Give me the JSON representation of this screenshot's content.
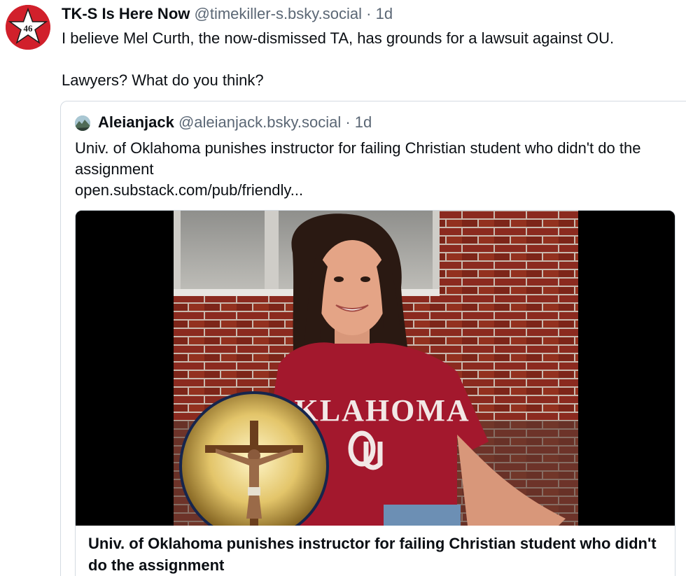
{
  "post": {
    "author_name": "TK-S Is Here Now",
    "author_handle": "@timekiller-s.bsky.social",
    "separator": "·",
    "time": "1d",
    "avatar_badge": "46",
    "text_line1": "I believe Mel Curth, the now-dismissed TA, has grounds for a lawsuit against OU.",
    "text_line2": "Lawyers? What do you think?"
  },
  "quote": {
    "author_name": "Aleianjack",
    "author_handle": "@aleianjack.bsky.social",
    "separator": "·",
    "time": "1d",
    "text": "Univ. of Oklahoma punishes instructor for failing Christian student who didn't do the assignment",
    "link": "open.substack.com/pub/friendly...",
    "card": {
      "shirt_text": "OKLAHOMA",
      "title": "Univ. of Oklahoma punishes instructor for failing Christian student who didn't do the assignment"
    }
  },
  "colors": {
    "avatar_red": "#d1202b",
    "handle_gray": "#5b6775",
    "border": "#d4dbe2",
    "shirt_crimson": "#a3182d",
    "brick": "#8b2a1f"
  }
}
